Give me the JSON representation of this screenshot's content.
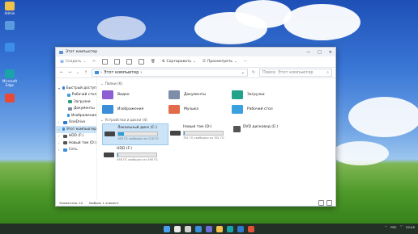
{
  "desktop": {
    "icons": [
      {
        "label": "Admin",
        "color": "#f0c24a"
      },
      {
        "label": "",
        "color": "#5a9be0"
      },
      {
        "label": "",
        "color": "#3c8fe8"
      },
      {
        "label": "Microsoft Edge",
        "color": "#1aa3a8"
      },
      {
        "label": "",
        "color": "#e94a35"
      }
    ]
  },
  "window": {
    "title": "Этот компьютер",
    "controls": {
      "minimize": "—",
      "maximize": "□",
      "close": "✕"
    },
    "toolbar": {
      "create": "Создать",
      "sort": "Сортировать",
      "view": "Просмотреть",
      "more": "···"
    },
    "address": {
      "path": "Этот компьютер",
      "search_placeholder": "Поиск: Этот компьютер"
    },
    "sidebar": [
      {
        "label": "Быстрый доступ",
        "icon": "star-icon",
        "color": "#3b7fd6",
        "indent": 0,
        "arrow": "▾"
      },
      {
        "label": "Рабочий стол",
        "icon": "desktop-folder-icon",
        "color": "#3aa0e0",
        "indent": 1,
        "arrow": ""
      },
      {
        "label": "Загрузки",
        "icon": "downloads-icon",
        "color": "#2f9d7a",
        "indent": 1,
        "arrow": ""
      },
      {
        "label": "Документы",
        "icon": "documents-icon",
        "color": "#7a8aa0",
        "indent": 1,
        "arrow": ""
      },
      {
        "label": "Изображения",
        "icon": "pictures-icon",
        "color": "#3a8fd8",
        "indent": 1,
        "arrow": ""
      },
      {
        "label": "OneDrive",
        "icon": "cloud-icon",
        "color": "#2f79d0",
        "indent": 0,
        "arrow": "›"
      },
      {
        "label": "Этот компьютер",
        "icon": "computer-icon",
        "color": "#3a8fd8",
        "indent": 0,
        "arrow": "›",
        "selected": true
      },
      {
        "label": "HDD (F:)",
        "icon": "drive-icon",
        "color": "#555555",
        "indent": 0,
        "arrow": "›"
      },
      {
        "label": "Новый том (D:)",
        "icon": "drive-icon",
        "color": "#555555",
        "indent": 0,
        "arrow": "›"
      },
      {
        "label": "Сеть",
        "icon": "network-icon",
        "color": "#3a8fd8",
        "indent": 0,
        "arrow": "›"
      }
    ],
    "folders_header": "Папки (6)",
    "folders": [
      {
        "label": "Видео",
        "icon": "video-folder-icon",
        "color": "#8d5fd3"
      },
      {
        "label": "Документы",
        "icon": "documents-folder-icon",
        "color": "#7d8ea8"
      },
      {
        "label": "Загрузки",
        "icon": "downloads-folder-icon",
        "color": "#23a28a"
      },
      {
        "label": "Изображения",
        "icon": "pictures-folder-icon",
        "color": "#3a8fd8"
      },
      {
        "label": "Музыка",
        "icon": "music-folder-icon",
        "color": "#e46b4a"
      },
      {
        "label": "Рабочий стол",
        "icon": "desktop-folder-icon",
        "color": "#3aa0e0"
      }
    ],
    "drives_header": "Устройства и диски (4)",
    "drives": [
      {
        "label": "Локальный диск (C:)",
        "sub": "188 ГБ свободно из 218 ГБ",
        "used": 0.14,
        "selected": true,
        "icon": "system-drive-icon"
      },
      {
        "label": "Новый том (D:)",
        "sub": "781 ГБ свободно из 781 ГБ",
        "used": 0.01,
        "selected": false,
        "icon": "drive-icon"
      },
      {
        "label": "DVD дисковод (E:)",
        "sub": "",
        "used": null,
        "selected": false,
        "icon": "dvd-drive-icon"
      },
      {
        "label": "HDD (F:)",
        "sub": "498 ГБ свободно из 498 ГБ",
        "used": 0.01,
        "selected": false,
        "icon": "drive-icon"
      }
    ],
    "status": {
      "count": "Элементов: 10",
      "selected": "Выбран 1 элемент"
    }
  },
  "taskbar": {
    "apps": [
      {
        "name": "start-icon",
        "color": "#4aa0f0"
      },
      {
        "name": "search-icon",
        "color": "#e8e8e8"
      },
      {
        "name": "task-view-icon",
        "color": "#d0d0d0"
      },
      {
        "name": "widgets-icon",
        "color": "#3b8fd8"
      },
      {
        "name": "chat-icon",
        "color": "#6b6fd8"
      },
      {
        "name": "explorer-icon",
        "color": "#f2c14e"
      },
      {
        "name": "edge-icon",
        "color": "#1aa3a8"
      },
      {
        "name": "store-icon",
        "color": "#2f79d0"
      },
      {
        "name": "office-icon",
        "color": "#e2513a"
      }
    ],
    "tray": {
      "lang": "РУС",
      "time": "22:45"
    }
  }
}
